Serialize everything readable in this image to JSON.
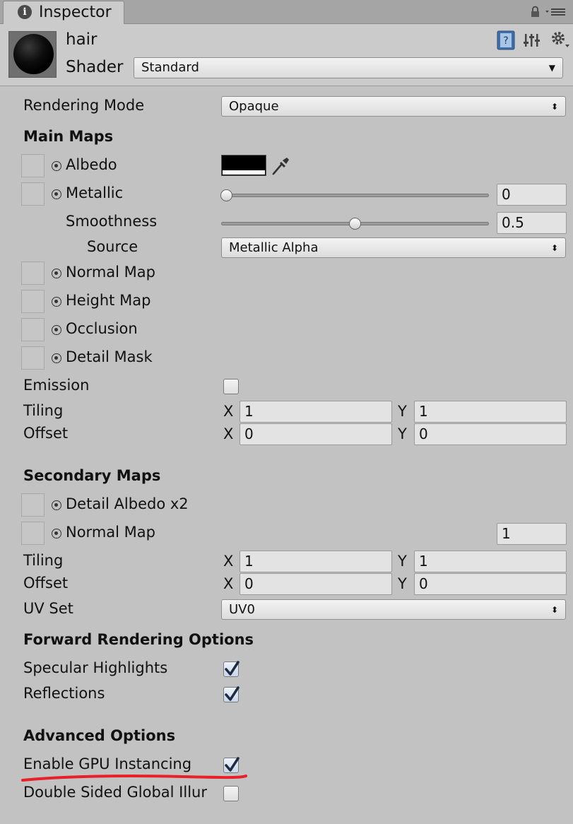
{
  "tab": {
    "title": "Inspector",
    "icon": "info-icon"
  },
  "header": {
    "material_name": "hair",
    "shader_label": "Shader",
    "shader_value": "Standard",
    "icons": [
      "help-book-icon",
      "preset-sliders-icon",
      "gear-icon"
    ]
  },
  "rendering_mode": {
    "label": "Rendering Mode",
    "value": "Opaque"
  },
  "main_maps": {
    "heading": "Main Maps",
    "albedo": {
      "label": "Albedo",
      "color": "#000000"
    },
    "metallic": {
      "label": "Metallic",
      "value": "0",
      "slider": 0.0
    },
    "smoothness": {
      "label": "Smoothness",
      "value": "0.5",
      "slider": 0.5
    },
    "source": {
      "label": "Source",
      "value": "Metallic Alpha"
    },
    "normal_map": {
      "label": "Normal Map"
    },
    "height_map": {
      "label": "Height Map"
    },
    "occlusion": {
      "label": "Occlusion"
    },
    "detail_mask": {
      "label": "Detail Mask"
    },
    "emission": {
      "label": "Emission",
      "checked": false
    },
    "tiling": {
      "label": "Tiling",
      "x_label": "X",
      "x": "1",
      "y_label": "Y",
      "y": "1"
    },
    "offset": {
      "label": "Offset",
      "x_label": "X",
      "x": "0",
      "y_label": "Y",
      "y": "0"
    }
  },
  "secondary_maps": {
    "heading": "Secondary Maps",
    "detail_albedo": {
      "label": "Detail Albedo x2"
    },
    "normal_map": {
      "label": "Normal Map",
      "value": "1"
    },
    "tiling": {
      "label": "Tiling",
      "x_label": "X",
      "x": "1",
      "y_label": "Y",
      "y": "1"
    },
    "offset": {
      "label": "Offset",
      "x_label": "X",
      "x": "0",
      "y_label": "Y",
      "y": "0"
    },
    "uv_set": {
      "label": "UV Set",
      "value": "UV0"
    }
  },
  "forward_rendering": {
    "heading": "Forward Rendering Options",
    "specular_highlights": {
      "label": "Specular Highlights",
      "checked": true
    },
    "reflections": {
      "label": "Reflections",
      "checked": true
    }
  },
  "advanced": {
    "heading": "Advanced Options",
    "gpu_instancing": {
      "label": "Enable GPU Instancing",
      "checked": true
    },
    "double_sided_gi": {
      "label": "Double Sided Global Illur",
      "checked": false
    }
  },
  "colors": {
    "annotation_underline": "#e8202a",
    "checkmark": "#1c2a44"
  }
}
